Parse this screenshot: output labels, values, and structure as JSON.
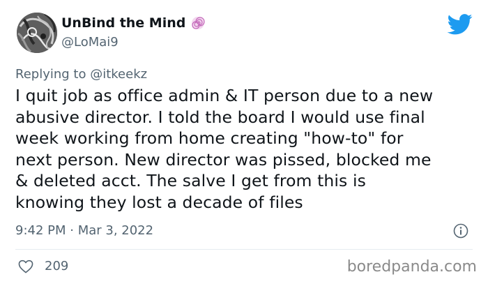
{
  "author": {
    "display_name": "UnBind the Mind",
    "handle": "@LoMai9",
    "emoji_icon": "cyclone-emoji",
    "avatar_icon": "avatar-image"
  },
  "reply": {
    "prefix": "Replying to ",
    "mention": "@itkeekz"
  },
  "tweet": {
    "lines": [
      "I quit job as office admin & IT person due to a new",
      "abusive director. I told the board I would use final",
      "week working from home creating \"how-to\" for",
      "next person. New director was pissed, blocked me",
      "& deleted acct. The salve I get from this is",
      "knowing they lost a decade of files"
    ]
  },
  "meta": {
    "timestamp": "9:42 PM · Mar 3, 2022"
  },
  "actions": {
    "like_count": "209"
  },
  "watermark": {
    "text": "boredpanda.com"
  },
  "colors": {
    "twitter_blue": "#1d9bf0",
    "secondary_text": "#536471",
    "primary_text": "#0f1419"
  }
}
